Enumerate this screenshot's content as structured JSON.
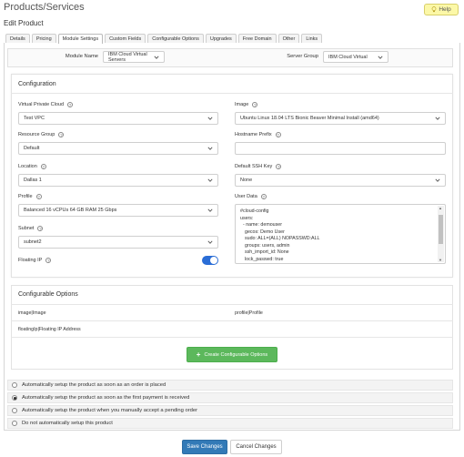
{
  "page": {
    "title": "Products/Services",
    "subtitle": "Edit Product",
    "help_label": "Help"
  },
  "tabs": [
    "Details",
    "Pricing",
    "Module Settings",
    "Custom Fields",
    "Configurable Options",
    "Upgrades",
    "Free Domain",
    "Other",
    "Links"
  ],
  "active_tab": "Module Settings",
  "module": {
    "module_name_label": "Module Name",
    "module_name_value": "IBM Cloud Virtual Servers",
    "server_group_label": "Server Group",
    "server_group_value": "IBM Cloud Virtual"
  },
  "configuration": {
    "title": "Configuration",
    "vpc_label": "Virtual Private Cloud",
    "vpc_value": "Test VPC",
    "image_label": "Image",
    "image_value": "Ubuntu Linux 18.04 LTS Bionic Beaver Minimal Install (amd64)",
    "resource_group_label": "Resource Group",
    "resource_group_value": "Default",
    "hostname_prefix_label": "Hostname Prefix",
    "hostname_prefix_value": "",
    "location_label": "Location",
    "location_value": "Dallas 1",
    "ssh_key_label": "Default SSH Key",
    "ssh_key_value": "None",
    "profile_label": "Profile",
    "profile_value": "Balanced 16 vCPUs 64 GB RAM 25 Gbps",
    "user_data_label": "User Data",
    "user_data_lines": [
      "#cloud-config",
      "users:",
      "  - name: demouser",
      "    gecos: Demo User",
      "    sudo: ALL=(ALL) NOPASSWD:ALL",
      "    groups: users, admin",
      "    ssh_import_id: None",
      "    lock_passwd: true"
    ],
    "subnet_label": "Subnet",
    "subnet_value": "subnet2",
    "floating_ip_label": "Floating IP",
    "floating_ip_enabled": true
  },
  "configurable_options": {
    "title": "Configurable Options",
    "row1_left": "image|Image",
    "row1_right": "profile|Profile",
    "row2_left": "floatingIp|Floating IP Address",
    "create_button": "Create Configurable Options"
  },
  "setup_options": {
    "items": [
      "Automatically setup the product as soon as an order is placed",
      "Automatically setup the product as soon as the first payment is received",
      "Automatically setup the product when you manually accept a pending order",
      "Do not automatically setup this product"
    ],
    "selected_index": 1
  },
  "footer": {
    "save_label": "Save Changes",
    "cancel_label": "Cancel Changes"
  },
  "colors": {
    "primary": "#337ab7",
    "success": "#5cb85c",
    "toggle_on": "#2a6dd6",
    "help_bg": "#fcf8a8"
  }
}
